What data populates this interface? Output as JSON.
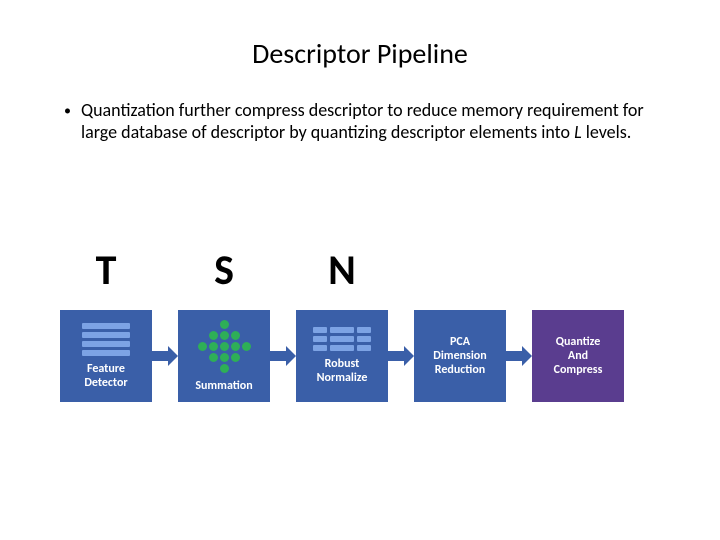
{
  "title": "Descriptor Pipeline",
  "bullet": {
    "pre": "Quantization further compress descriptor to reduce memory requirement for large database of descriptor by quantizing descriptor elements into ",
    "ital": "L",
    "post": " levels."
  },
  "pipeline": [
    {
      "letter": "T",
      "label": "Feature\nDetector",
      "kind": "feat",
      "color": "blue"
    },
    {
      "letter": "S",
      "label": "Summation",
      "kind": "sum",
      "color": "blue"
    },
    {
      "letter": "N",
      "label": "Robust\nNormalize",
      "kind": "norm",
      "color": "blue"
    },
    {
      "letter": "",
      "label": "PCA\nDimension\nReduction",
      "kind": "plain",
      "color": "blue"
    },
    {
      "letter": "",
      "label": "Quantize\nAnd\nCompress",
      "kind": "plain",
      "color": "purple"
    }
  ]
}
